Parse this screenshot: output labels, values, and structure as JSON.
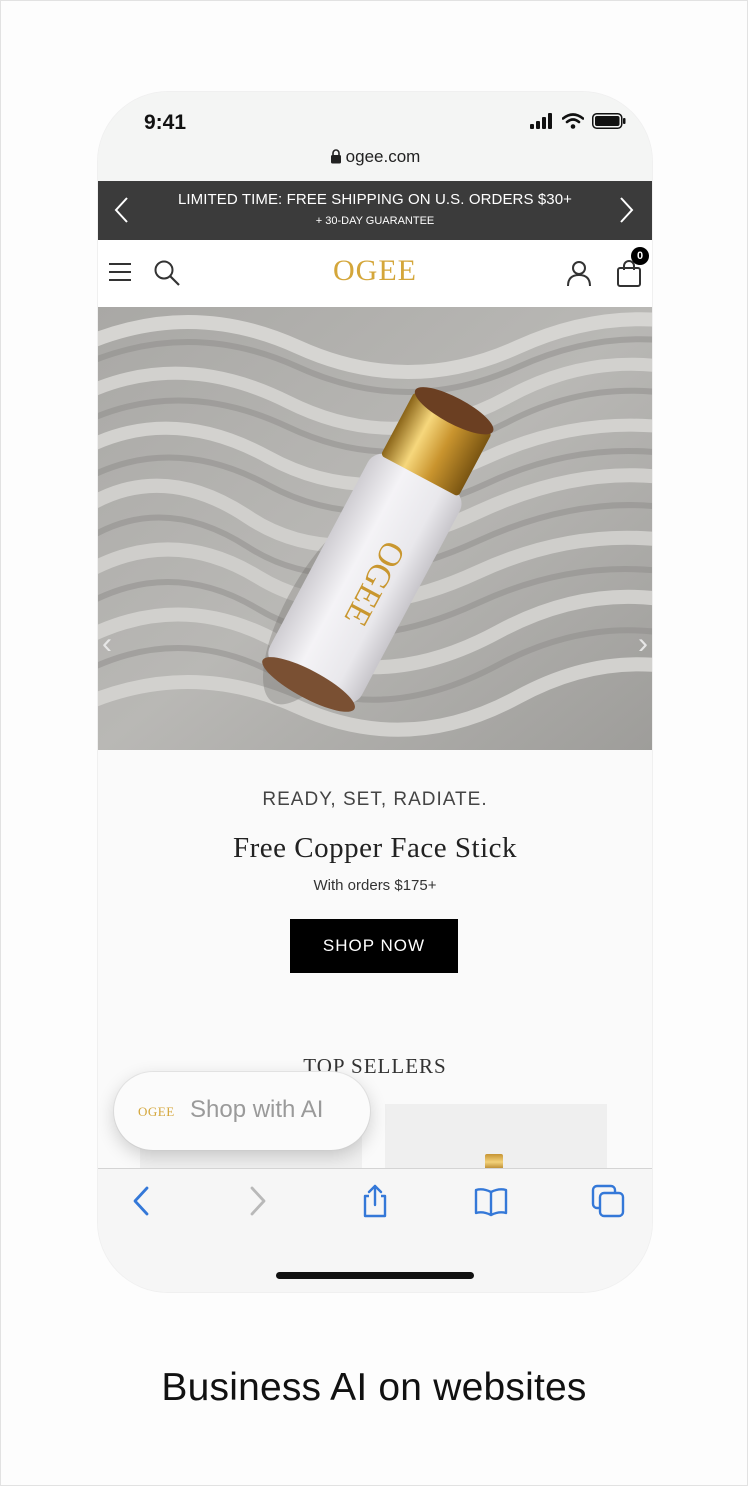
{
  "status_bar": {
    "time": "9:41",
    "signal_icon": "cellular-signal-icon",
    "wifi_icon": "wifi-icon",
    "battery_icon": "battery-icon"
  },
  "browser": {
    "url": "ogee.com",
    "lock_icon": "lock-icon"
  },
  "promo_bar": {
    "main_text": "LIMITED TIME: FREE SHIPPING ON U.S. ORDERS $30+",
    "sub_text": "+ 30-DAY GUARANTEE",
    "prev_icon": "chevron-left-icon",
    "next_icon": "chevron-right-icon"
  },
  "site_header": {
    "logo": "OGEE",
    "menu_icon": "hamburger-menu-icon",
    "search_icon": "search-icon",
    "account_icon": "account-icon",
    "cart_icon": "shopping-bag-icon",
    "cart_count": "0"
  },
  "hero": {
    "image": "white-face-stick-on-sand",
    "product_logo": "OGEE",
    "prev_arrow": "‹",
    "next_arrow": "›"
  },
  "promo_section": {
    "eyebrow": "READY, SET, RADIATE.",
    "headline": "Free Copper Face Stick",
    "subline": "With orders $175+",
    "cta_label": "SHOP NOW"
  },
  "top_sellers": {
    "title": "TOP SELLERS"
  },
  "ai_assistant": {
    "logo": "OGEE",
    "label": "Shop with AI"
  },
  "toolbar": {
    "back_icon": "back-arrow-icon",
    "forward_icon": "forward-arrow-icon",
    "share_icon": "share-icon",
    "bookmarks_icon": "bookmarks-icon",
    "tabs_icon": "tabs-icon"
  },
  "caption": "Business AI on websites",
  "colors": {
    "brand_gold": "#d4a63a",
    "promo_bar_bg": "#3b3b3b",
    "safari_blue": "#3478d8",
    "cta_bg": "#000000"
  }
}
